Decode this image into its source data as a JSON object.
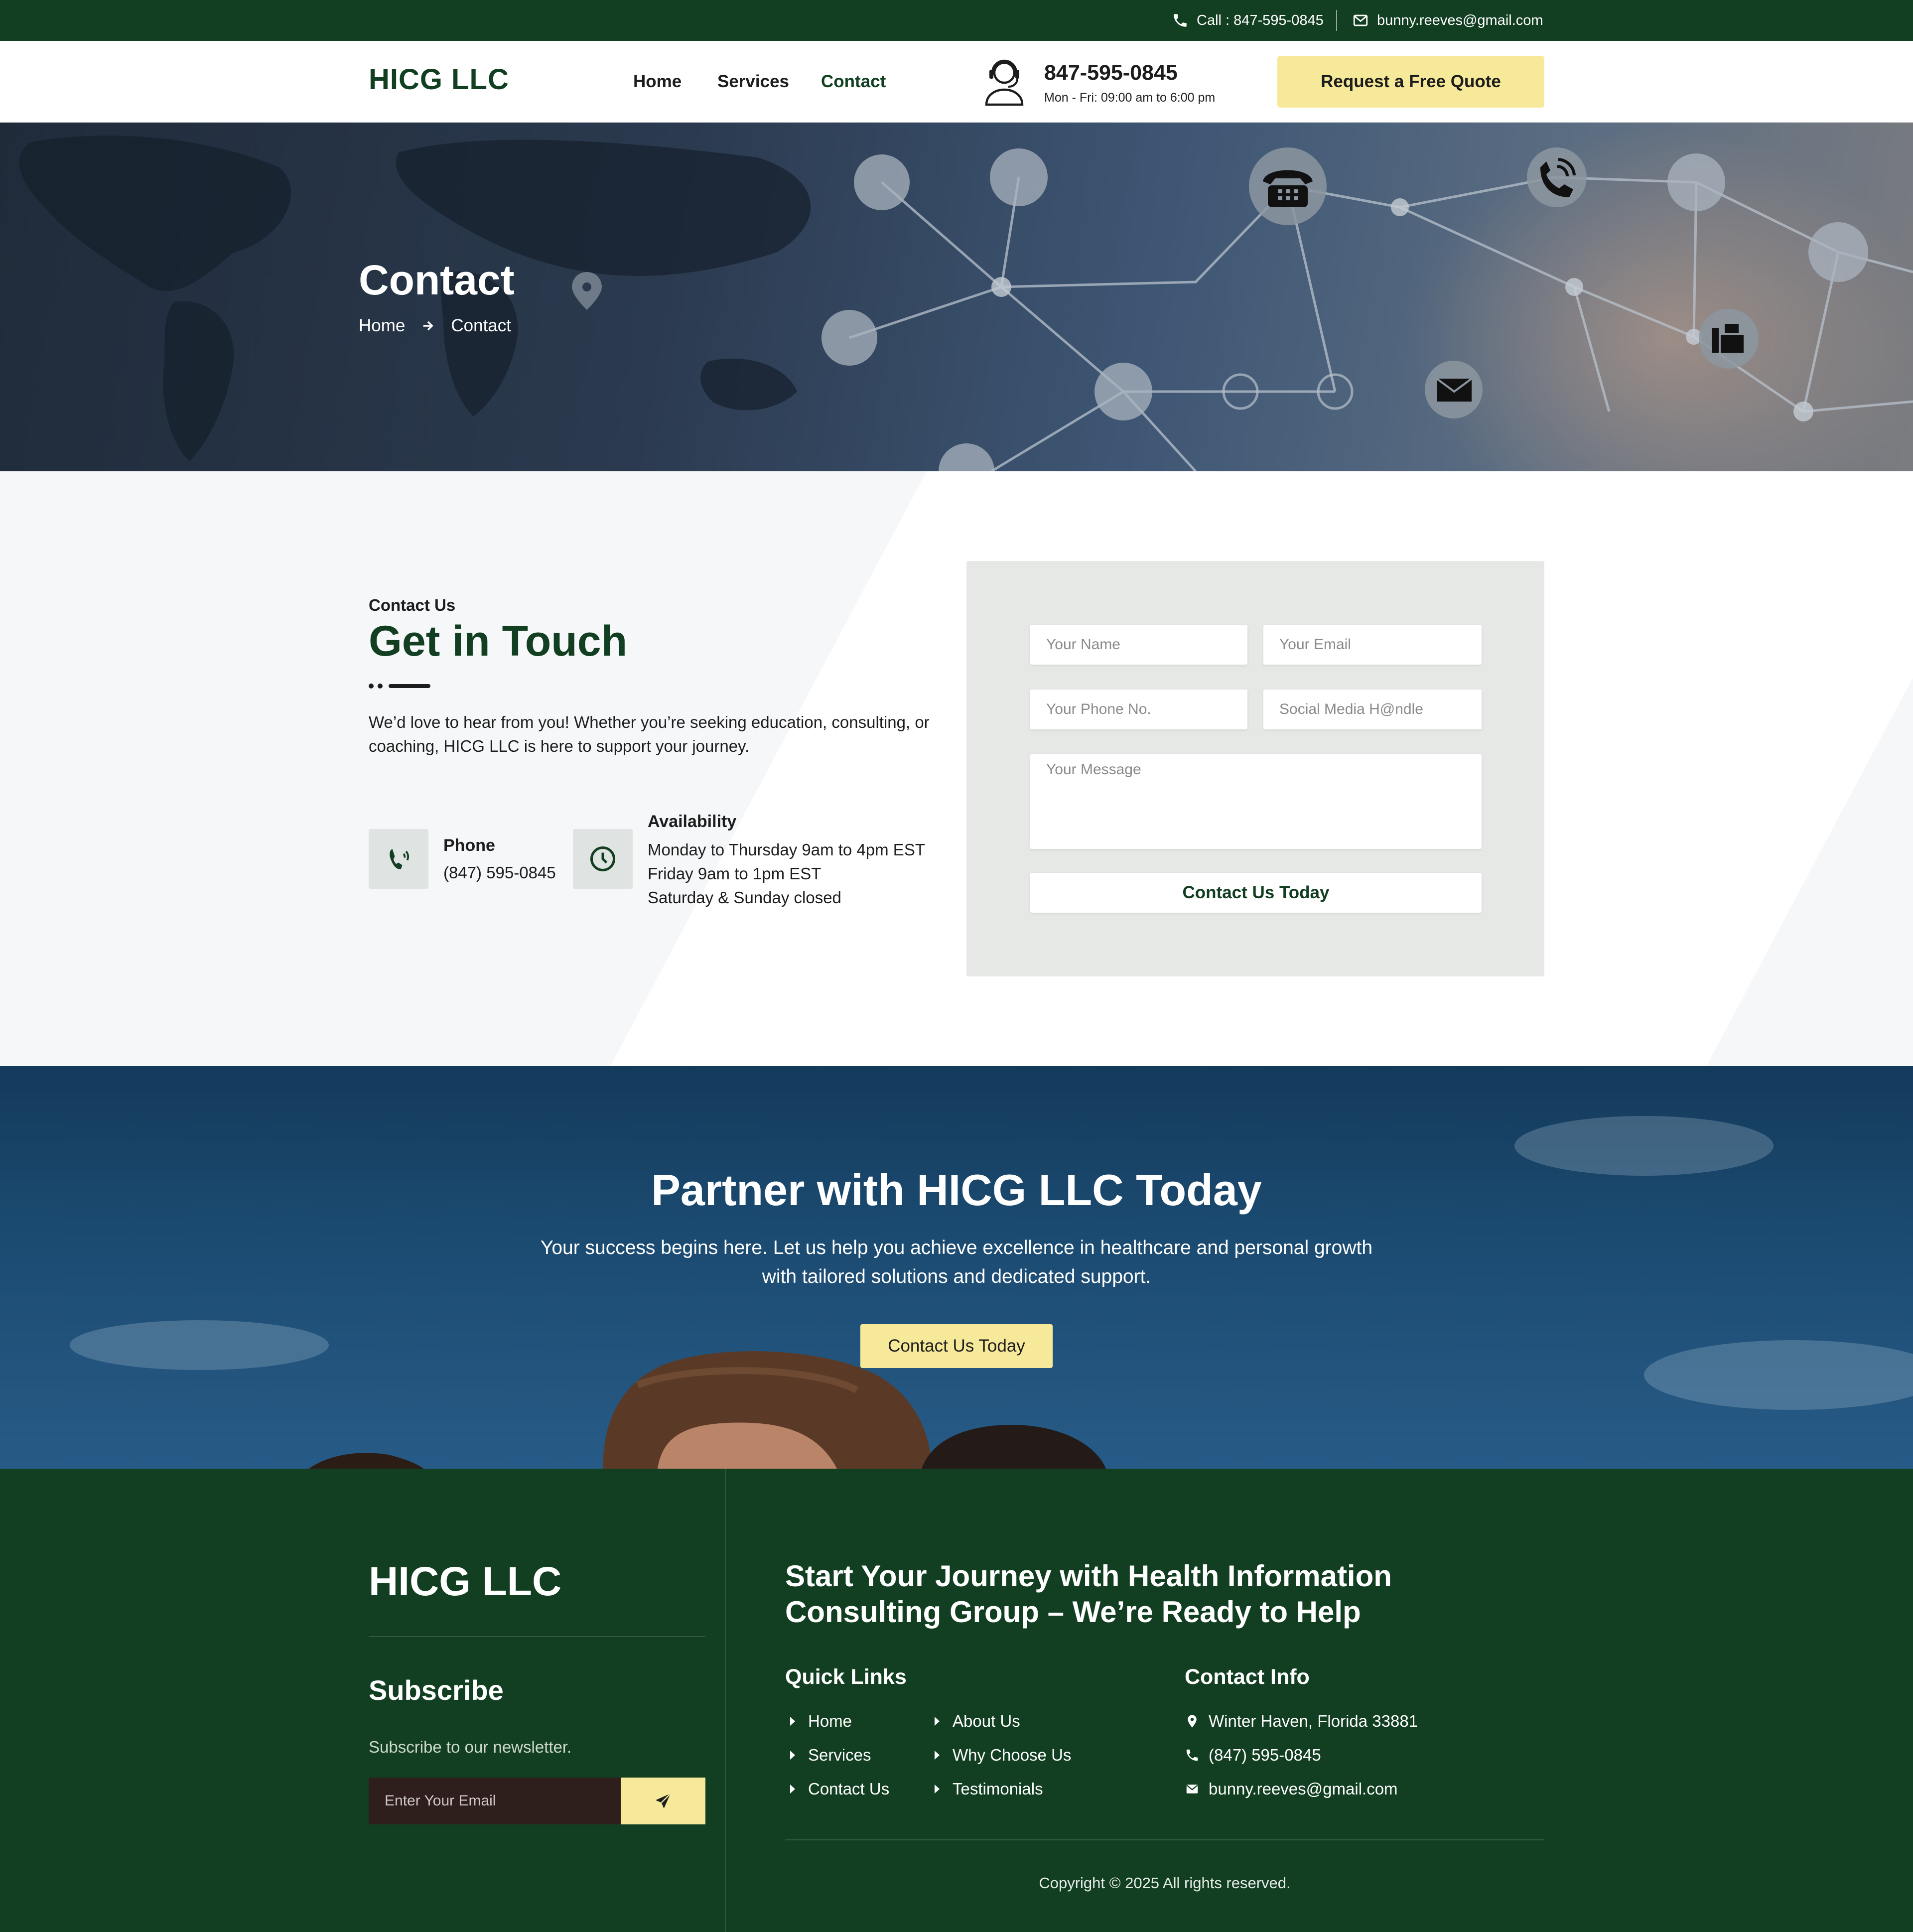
{
  "colors": {
    "brand_green": "#123f21",
    "accent_yellow": "#f7e99a",
    "hero_blue": "#2b3a4f",
    "cta_blue": "#1b4a70"
  },
  "topbar": {
    "call": "Call : 847-595-0845",
    "email": "bunny.reeves@gmail.com",
    "call_icon": "phone-icon",
    "email_icon": "envelope-icon"
  },
  "header": {
    "logo": "HICG LLC",
    "nav": [
      "Home",
      "Services",
      "Contact"
    ],
    "active_nav": "Contact",
    "phone": "847-595-0845",
    "hours": "Mon - Fri: 09:00 am to 6:00 pm",
    "quote_button": "Request a Free Quote",
    "agent_icon": "headset-agent-icon"
  },
  "hero": {
    "title": "Contact",
    "breadcrumb": [
      "Home",
      "Contact"
    ]
  },
  "contact": {
    "eyebrow": "Contact Us",
    "title": "Get in Touch",
    "description": "We’d love to hear from you! Whether you’re seeking education, consulting, or coaching, HICG LLC is here to support your journey.",
    "phone_label": "Phone",
    "phone_value": "(847) 595-0845",
    "availability_label": "Availability",
    "availability_lines": [
      "Monday to Thursday 9am to 4pm EST",
      "Friday 9am to 1pm EST",
      "Saturday & Sunday closed"
    ]
  },
  "form": {
    "name_placeholder": "Your Name",
    "email_placeholder": "Your Email",
    "phone_placeholder": "Your Phone No.",
    "social_placeholder": "Social Media H@ndle",
    "message_placeholder": "Your Message",
    "submit": "Contact Us Today"
  },
  "cta": {
    "title": "Partner with HICG LLC Today",
    "text": "Your success begins here. Let us help you achieve excellence in healthcare and personal growth with tailored solutions and dedicated support.",
    "button": "Contact Us Today"
  },
  "footer": {
    "logo": "HICG LLC",
    "subscribe_title": "Subscribe",
    "subscribe_text": "Subscribe to our newsletter.",
    "email_placeholder": "Enter Your Email",
    "headline": "Start Your Journey with Health Information Consulting Group – We’re Ready to Help",
    "quick_links_title": "Quick Links",
    "quick_links": [
      "Home",
      "Services",
      "Contact Us",
      "About Us",
      "Why Choose Us",
      "Testimonials"
    ],
    "contact_title": "Contact Info",
    "contact_info": [
      "Winter Haven, Florida 33881",
      "(847) 595-0845",
      "bunny.reeves@gmail.com"
    ],
    "copyright": "Copyright © 2025 All rights reserved."
  }
}
